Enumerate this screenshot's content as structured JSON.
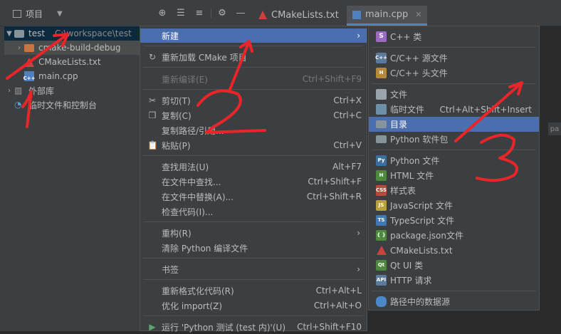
{
  "toolbar": {
    "project_label": "项目",
    "tabs": [
      {
        "label": "CMakeLists.txt"
      },
      {
        "label": "main.cpp"
      }
    ]
  },
  "tree": {
    "root_name": "test",
    "root_path": "C:\\workspace\\test",
    "items": [
      {
        "label": "cmake-build-debug"
      },
      {
        "label": "CMakeLists.txt"
      },
      {
        "label": "main.cpp"
      },
      {
        "label": "外部库"
      },
      {
        "label": "临时文件和控制台"
      }
    ]
  },
  "menu1": {
    "new": "新建",
    "reload": "重新加载 CMake 项目",
    "recompile": "重新编译(E)",
    "recompile_sc": "Ctrl+Shift+F9",
    "cut": "剪切(T)",
    "cut_sc": "Ctrl+X",
    "copy": "复制(C)",
    "copy_sc": "Ctrl+C",
    "copy_path": "复制路径/引用...",
    "paste": "粘贴(P)",
    "paste_sc": "Ctrl+V",
    "find_usages": "查找用法(U)",
    "find_usages_sc": "Alt+F7",
    "find_in_files": "在文件中查找...",
    "find_in_files_sc": "Ctrl+Shift+F",
    "replace_in_files": "在文件中替换(A)...",
    "replace_in_files_sc": "Ctrl+Shift+R",
    "inspect": "检查代码(I)...",
    "refactor": "重构(R)",
    "clean_python": "清除 Python 编译文件",
    "bookmarks": "书签",
    "reformat": "重新格式化代码(R)",
    "reformat_sc": "Ctrl+Alt+L",
    "optimize": "优化 import(Z)",
    "optimize_sc": "Ctrl+Alt+O",
    "run": "运行 'Python 测试 (test 内)'(U)",
    "run_sc": "Ctrl+Shift+F10"
  },
  "menu2": {
    "cpp_class": "C++ 类",
    "src_file": "C/C++ 源文件",
    "header_file": "C/C++ 头文件",
    "file": "文件",
    "scratch": "临时文件",
    "scratch_sc": "Ctrl+Alt+Shift+Insert",
    "directory": "目录",
    "python_package": "Python 软件包",
    "python_file": "Python 文件",
    "html_file": "HTML 文件",
    "stylesheet": "样式表",
    "js_file": "JavaScript 文件",
    "ts_file": "TypeScript 文件",
    "package_json": "package.json文件",
    "cmakelists": "CMakeLists.txt",
    "qt_ui": "Qt UI 类",
    "http": "HTTP 请求",
    "datasource": "路径中的数据源"
  },
  "side": {
    "pa": "pa"
  },
  "colors": {
    "menu_highlight": "#4b6eaf",
    "annotation": "#e8262a"
  }
}
